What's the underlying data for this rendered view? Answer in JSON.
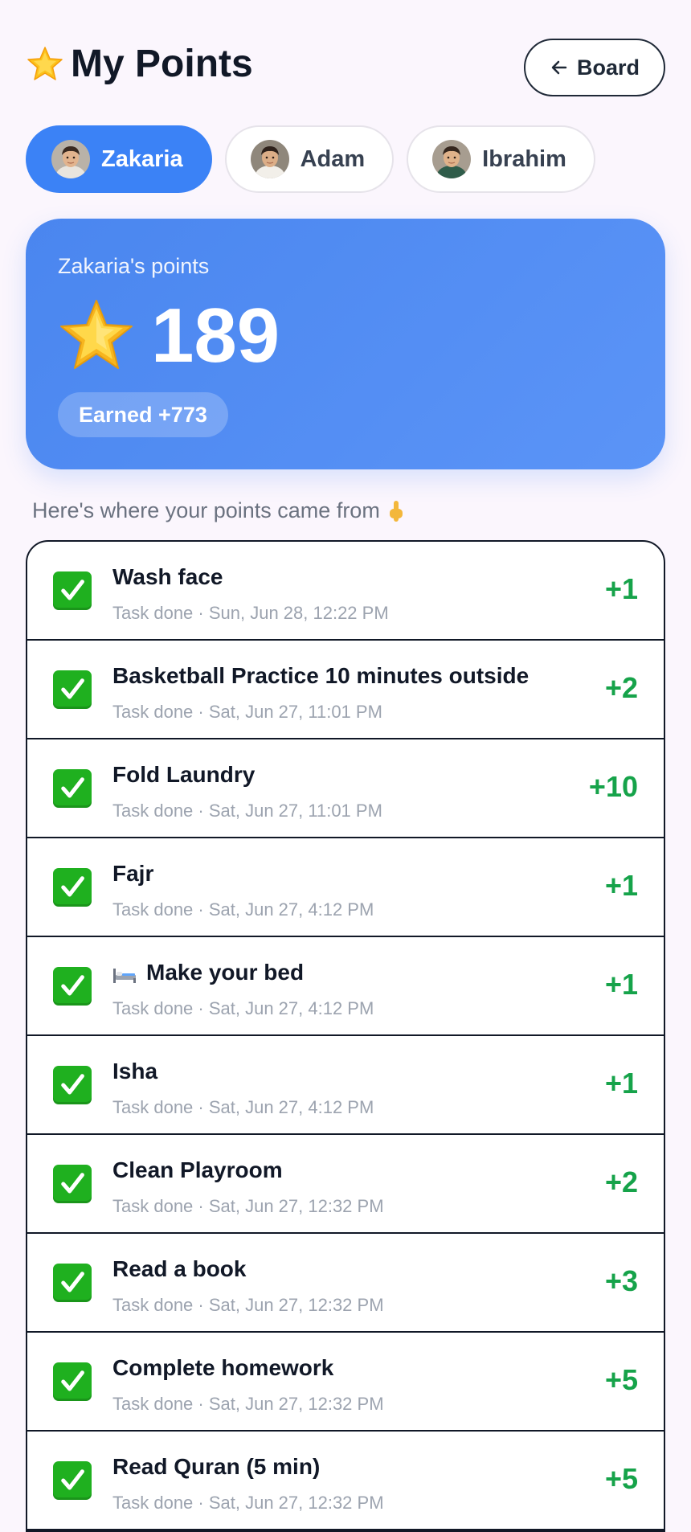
{
  "header": {
    "title": "My Points",
    "board_button": "Board"
  },
  "kids": [
    {
      "name": "Zakaria",
      "active": true
    },
    {
      "name": "Adam",
      "active": false
    },
    {
      "name": "Ibrahim",
      "active": false
    }
  ],
  "points_card": {
    "label": "Zakaria's points",
    "points": "189",
    "earned": "Earned +773"
  },
  "history_subtitle": "Here's where your points came from",
  "colors": {
    "accent": "#3b82f6",
    "positive": "#16a34a",
    "check": "#1fb01f"
  },
  "history": [
    {
      "title": "Wash face",
      "meta": "Task done · Sun, Jun 28, 12:22 PM",
      "points": "+1",
      "icon": null
    },
    {
      "title": "Basketball Practice 10 minutes outside",
      "meta": "Task done · Sat, Jun 27, 11:01 PM",
      "points": "+2",
      "icon": null
    },
    {
      "title": "Fold Laundry",
      "meta": "Task done · Sat, Jun 27, 11:01 PM",
      "points": "+10",
      "icon": null
    },
    {
      "title": "Fajr",
      "meta": "Task done · Sat, Jun 27, 4:12 PM",
      "points": "+1",
      "icon": null
    },
    {
      "title": "Make your bed",
      "meta": "Task done · Sat, Jun 27, 4:12 PM",
      "points": "+1",
      "icon": "bed-icon"
    },
    {
      "title": "Isha",
      "meta": "Task done · Sat, Jun 27, 4:12 PM",
      "points": "+1",
      "icon": null
    },
    {
      "title": "Clean Playroom",
      "meta": "Task done · Sat, Jun 27, 12:32 PM",
      "points": "+2",
      "icon": null
    },
    {
      "title": "Read a book",
      "meta": "Task done · Sat, Jun 27, 12:32 PM",
      "points": "+3",
      "icon": null
    },
    {
      "title": "Complete homework",
      "meta": "Task done · Sat, Jun 27, 12:32 PM",
      "points": "+5",
      "icon": null
    },
    {
      "title": "Read Quran (5 min)",
      "meta": "Task done · Sat, Jun 27, 12:32 PM",
      "points": "+5",
      "icon": null
    }
  ]
}
